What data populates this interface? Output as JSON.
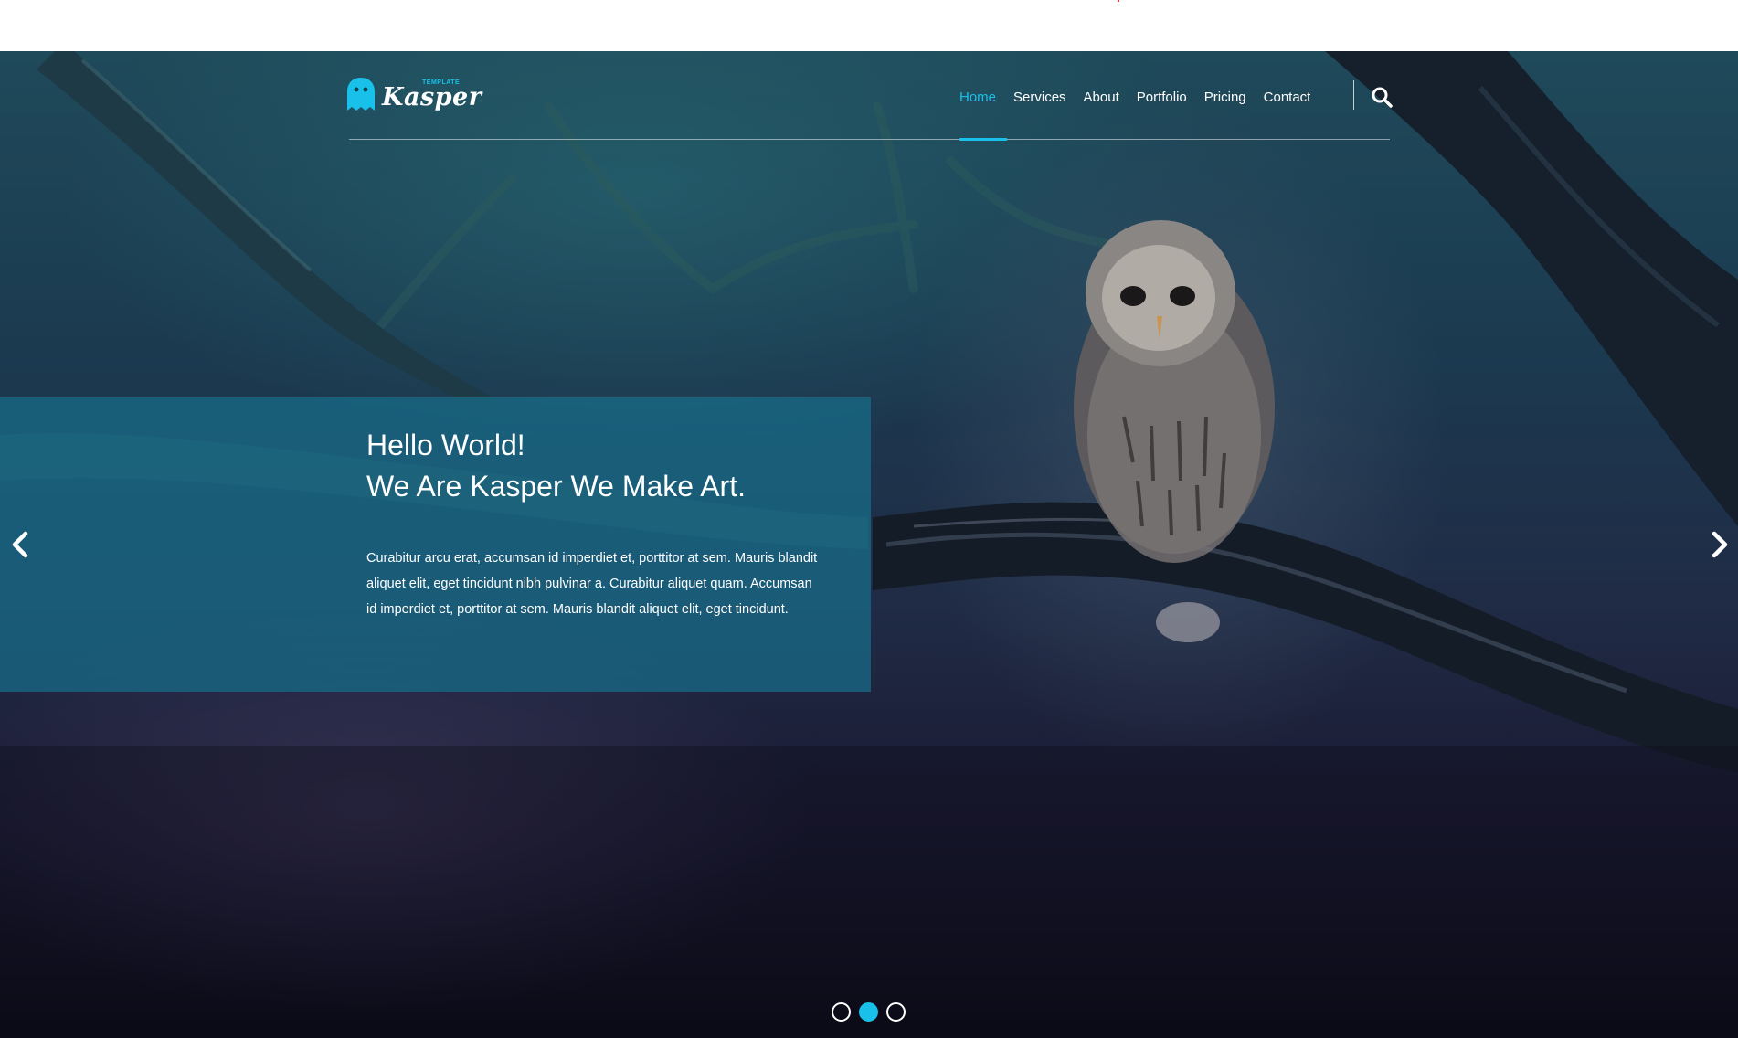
{
  "brand": {
    "logo_small": "TEMPLATE",
    "logo_name": "Kasper",
    "accent_color": "#19c1ea",
    "logo_icon": "ghost-icon"
  },
  "nav": {
    "items": [
      {
        "label": "Home",
        "active": true
      },
      {
        "label": "Services",
        "active": false
      },
      {
        "label": "About",
        "active": false
      },
      {
        "label": "Portfolio",
        "active": false
      },
      {
        "label": "Pricing",
        "active": false
      },
      {
        "label": "Contact",
        "active": false
      }
    ],
    "search_icon": "search-icon"
  },
  "hero": {
    "heading_line1": "Hello World!",
    "heading_line2": "We Are Kasper We Make Art.",
    "body": "Curabitur arcu erat, accumsan id imperdiet et, porttitor at sem. Mauris blandit aliquet elit, eget tincidunt nibh pulvinar a. Curabitur aliquet quam. Accumsan id imperdiet et, porttitor at sem. Mauris blandit aliquet elit, eget tincidunt.",
    "caption_bg": "#186e8a",
    "prev_icon": "chevron-left-icon",
    "next_icon": "chevron-right-icon"
  },
  "slider": {
    "slide_count": 3,
    "active_index": 1
  }
}
